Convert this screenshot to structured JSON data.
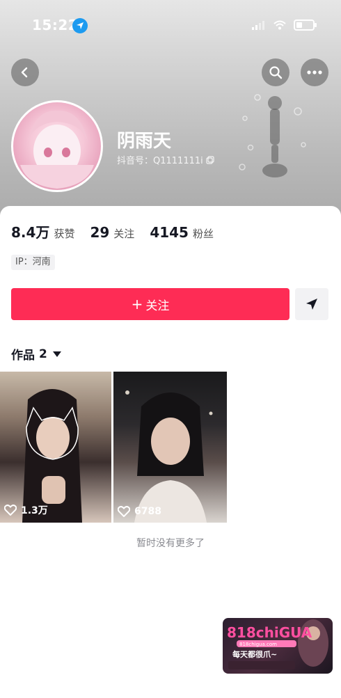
{
  "status_bar": {
    "time": "15:22",
    "battery": 0.35
  },
  "profile": {
    "nickname": "阴雨天",
    "douyin_id": "抖音号：Q1111111i"
  },
  "stats": [
    {
      "value": "8.4万",
      "label": "获赞"
    },
    {
      "value": "29",
      "label": "关注"
    },
    {
      "value": "4145",
      "label": "粉丝"
    }
  ],
  "ip": "IP：河南",
  "actions": {
    "follow_label": "关注",
    "follow_symbol": "+"
  },
  "works": {
    "label": "作品",
    "count": "2",
    "items": [
      {
        "likes": "1.3万"
      },
      {
        "likes": "6788"
      }
    ],
    "no_more": "暂时没有更多了"
  },
  "watermark": {
    "logo": "818chiGUA",
    "site": "818chigua.com",
    "slogan": "每天都很爪~"
  },
  "colors": {
    "accent": "#fe2c55",
    "location": "#1d9bf0"
  },
  "icons": [
    "back-icon",
    "search-icon",
    "more-icon",
    "send-icon",
    "heart-icon",
    "copy-icon",
    "location-arrow-icon",
    "signal-icon",
    "wifi-icon",
    "battery-icon"
  ]
}
